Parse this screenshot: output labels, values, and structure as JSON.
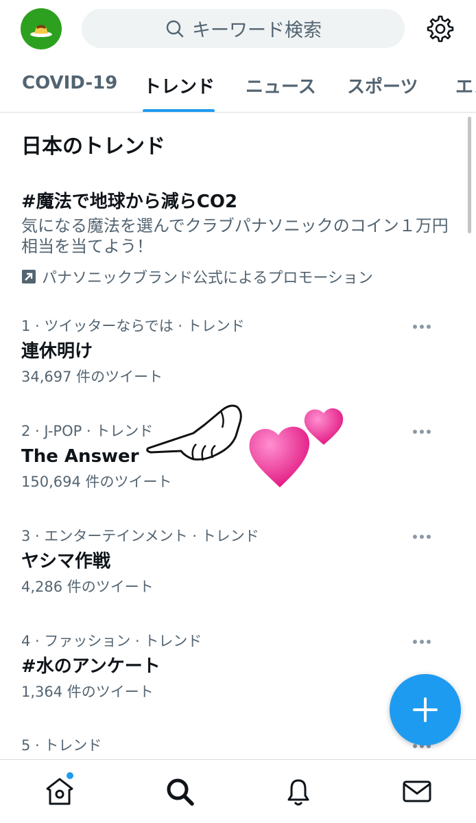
{
  "header": {
    "avatar_icon": "pudding-icon",
    "search_placeholder": "キーワード検索",
    "settings_icon": "gear-icon"
  },
  "tabs": [
    {
      "label": "COVID-19",
      "active": false
    },
    {
      "label": "トレンド",
      "active": true
    },
    {
      "label": "ニュース",
      "active": false
    },
    {
      "label": "スポーツ",
      "active": false
    },
    {
      "label": "エン",
      "active": false
    }
  ],
  "section_title": "日本のトレンド",
  "promoted": {
    "title": "#魔法で地球から減らCO2",
    "description": "気になる魔法を選んでクラブパナソニックのコイン１万円相当を当てよう！",
    "promoted_by": "パナソニックブランド公式によるプロモーション"
  },
  "trends": [
    {
      "meta": "1 · ツイッターならでは · トレンド",
      "name": "連休明け",
      "count": "34,697 件のツイート"
    },
    {
      "meta": "2 · J-POP · トレンド",
      "name": "The Answer",
      "count": "150,694 件のツイート"
    },
    {
      "meta": "3 · エンターテインメント · トレンド",
      "name": "ヤシマ作戦",
      "count": "4,286 件のツイート"
    },
    {
      "meta": "4 · ファッション · トレンド",
      "name": "#水のアンケート",
      "count": "1,364 件のツイート"
    },
    {
      "meta": "5 · トレンド",
      "name": "",
      "count": ""
    }
  ],
  "fab": {
    "icon": "plus-icon",
    "color": "#1d9bf0"
  },
  "bottom_nav": [
    {
      "icon": "home-icon",
      "has_dot": true
    },
    {
      "icon": "search-icon",
      "active": true
    },
    {
      "icon": "bell-icon"
    },
    {
      "icon": "mail-icon"
    }
  ],
  "stickers": [
    "pointing-hand-icon",
    "two-hearts-icon"
  ],
  "colors": {
    "accent": "#1d9bf0",
    "text": "#0f1419",
    "muted": "#536471"
  }
}
